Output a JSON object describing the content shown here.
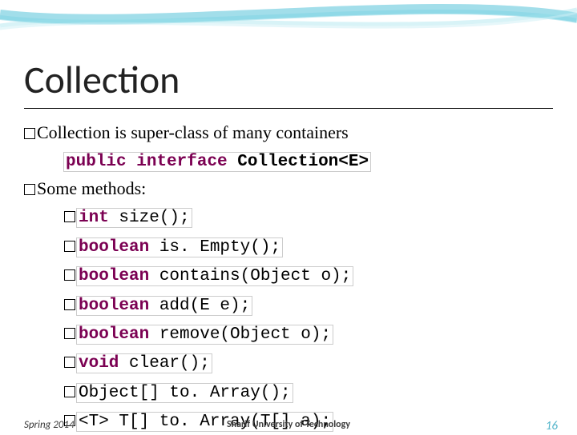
{
  "title": "Collection",
  "lines": {
    "l1_pre": "Collection is super-class of many containers",
    "l2_kw1": "public",
    "l2_kw2": "interface",
    "l2_rest": "Collection<E>",
    "l3": "Some methods:",
    "m1_t": "int",
    "m1_r": " size();",
    "m2_t": "boolean",
    "m2_r": " is. Empty();",
    "m3_t": "boolean",
    "m3_r": " contains(Object o);",
    "m4_t": "boolean",
    "m4_r": " add(E e);",
    "m5_t": "boolean",
    "m5_r": " remove(Object o);",
    "m6_t": "void",
    "m6_r": " clear();",
    "m7": "Object[] to. Array();",
    "m8": "<T> T[] to. Array(T[] a);"
  },
  "footer": {
    "left": "Spring 2014",
    "center": "Sharif University of Technology",
    "right": "16"
  }
}
